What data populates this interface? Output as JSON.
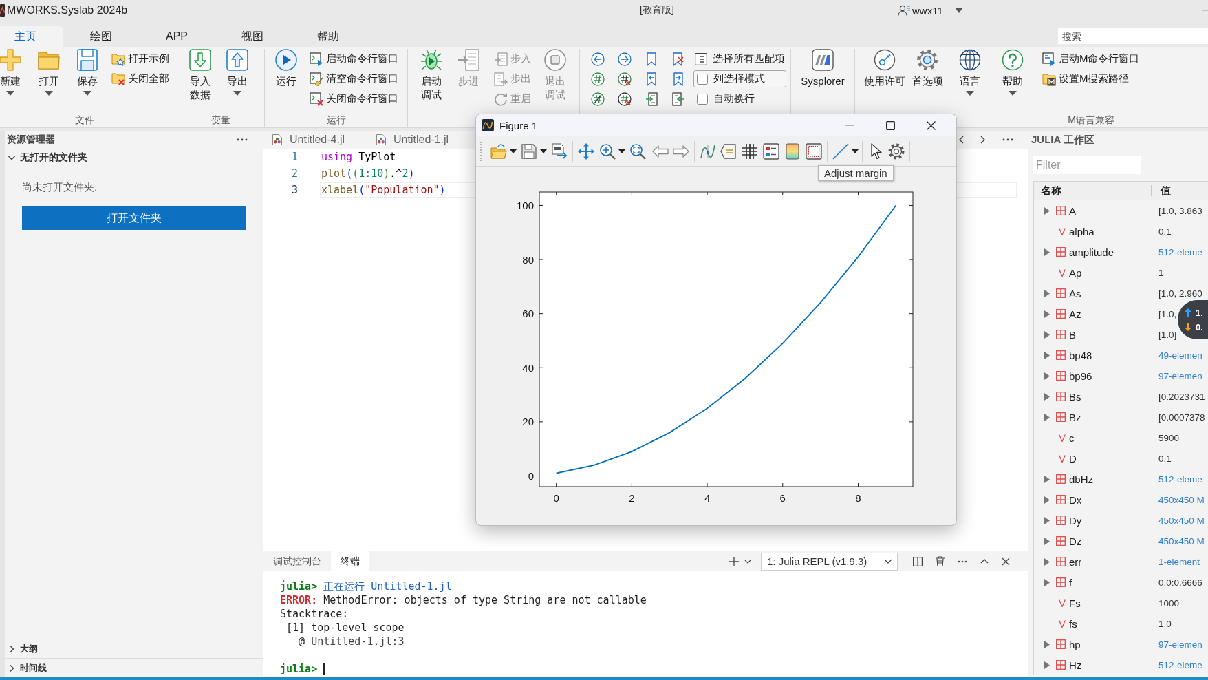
{
  "title_bar": {
    "app_name": "MWORKS.Syslab 2024b",
    "edition": "[教育版]",
    "user": "wwx11"
  },
  "ribbon_tabs": [
    {
      "label": "主页",
      "selected": true
    },
    {
      "label": "绘图",
      "selected": false
    },
    {
      "label": "APP",
      "selected": false
    },
    {
      "label": "视图",
      "selected": false
    },
    {
      "label": "帮助",
      "selected": false
    }
  ],
  "search": {
    "placeholder": "搜索"
  },
  "ribbon": {
    "file_group": {
      "label": "文件",
      "large_buttons": [
        "新建",
        "打开",
        "保存"
      ],
      "small_buttons": [
        "打开示例",
        "关闭全部"
      ]
    },
    "variable_group": {
      "label": "变量",
      "large_buttons": [
        "导入数据",
        "导出"
      ]
    },
    "run_group": {
      "label": "运行",
      "large_buttons": [
        "运行"
      ],
      "small_buttons": [
        "启动命令行窗口",
        "清空命令行窗口",
        "关闭命令行窗口"
      ]
    },
    "debug_group": {
      "large_buttons": [
        {
          "label": "启动调试",
          "disabled": false
        },
        {
          "label": "步进",
          "disabled": true
        },
        {
          "label": "退出调试",
          "disabled": true
        }
      ],
      "small_buttons": [
        {
          "label": "步入",
          "disabled": true
        },
        {
          "label": "步出",
          "disabled": true
        },
        {
          "label": "重启",
          "disabled": true
        }
      ]
    },
    "edit_group": {
      "select_all_button": "选择所有匹配项",
      "checkboxes": [
        {
          "label": "列选择模式",
          "checked": false,
          "focused": true
        },
        {
          "label": "自动换行",
          "checked": false,
          "focused": false
        }
      ]
    },
    "sysplorer_group": {
      "large_buttons": [
        "Sysplorer"
      ]
    },
    "environment_group": {
      "large_buttons": [
        "使用许可",
        "首选项",
        "语言",
        "帮助"
      ]
    },
    "m_language_group": {
      "label": "M语言兼容",
      "small_buttons": [
        "启动M命令行窗口",
        "设置M搜索路径"
      ]
    }
  },
  "explorer": {
    "title": "资源管理器",
    "folder_section": {
      "label": "无打开的文件夹",
      "expanded": true
    },
    "message": "尚未打开文件夹.",
    "open_folder_button": "打开文件夹",
    "bottom_sections": [
      {
        "label": "大纲",
        "expanded": false
      },
      {
        "label": "时间线",
        "expanded": false
      }
    ]
  },
  "editor": {
    "tabs": [
      {
        "label": "Untitled-4.jl"
      },
      {
        "label": "Untitled-1.jl"
      }
    ],
    "lines": [
      {
        "number": "1",
        "current": false,
        "tokens": [
          {
            "text": "using",
            "kind": "keyword"
          },
          {
            "text": " TyPlot",
            "kind": "plain"
          }
        ]
      },
      {
        "number": "2",
        "current": false,
        "tokens": [
          {
            "text": "plot",
            "kind": "function"
          },
          {
            "text": "(",
            "kind": "bracket1"
          },
          {
            "text": "(",
            "kind": "bracket2"
          },
          {
            "text": "1:10",
            "kind": "number"
          },
          {
            "text": ")",
            "kind": "bracket2"
          },
          {
            "text": ".^",
            "kind": "plain"
          },
          {
            "text": "2",
            "kind": "number"
          },
          {
            "text": ")",
            "kind": "bracket1"
          }
        ]
      },
      {
        "number": "3",
        "current": true,
        "tokens": [
          {
            "text": "xlabel",
            "kind": "function"
          },
          {
            "text": "(",
            "kind": "bracket1"
          },
          {
            "text": "\"Population\"",
            "kind": "string"
          },
          {
            "text": ")",
            "kind": "bracket1"
          }
        ]
      }
    ]
  },
  "figure_window": {
    "title": "Figure 1",
    "tooltip": "Adjust margin",
    "chart_data": {
      "type": "line",
      "x": [
        0,
        1,
        2,
        3,
        4,
        5,
        6,
        7,
        8,
        9
      ],
      "series": [
        {
          "color": "#0072bd",
          "values": [
            1,
            4,
            9,
            16,
            25,
            36,
            49,
            64,
            81,
            100
          ]
        }
      ],
      "xlim": [
        -0.45,
        9.45
      ],
      "ylim": [
        -3.95,
        104.95
      ],
      "xticks": [
        0,
        2,
        4,
        6,
        8
      ],
      "yticks": [
        0,
        20,
        40,
        60,
        80,
        100
      ]
    }
  },
  "panel": {
    "tabs": [
      {
        "label": "调试控制台",
        "selected": false
      },
      {
        "label": "终端",
        "selected": true
      }
    ],
    "terminal_selector": "1: Julia REPL (v1.9.3)",
    "terminal_lines": [
      {
        "tokens": [
          {
            "text": "julia>",
            "kind": "prompt"
          },
          {
            "text": " 正在运行 Untitled-1.jl",
            "kind": "info"
          }
        ]
      },
      {
        "tokens": [
          {
            "text": "ERROR:",
            "kind": "error"
          },
          {
            "text": " MethodError: objects of type String are not callable",
            "kind": "plain"
          }
        ]
      },
      {
        "tokens": [
          {
            "text": "Stacktrace:",
            "kind": "plain"
          }
        ]
      },
      {
        "tokens": [
          {
            "text": " [1] top-level scope",
            "kind": "plain"
          }
        ]
      },
      {
        "tokens": [
          {
            "text": "   @ ",
            "kind": "plain"
          },
          {
            "text": "Untitled-1.jl:3",
            "kind": "link"
          }
        ]
      }
    ],
    "input_prompt": "julia>"
  },
  "workspace": {
    "title": "JULIA 工作区",
    "filter": {
      "placeholder": "Filter"
    },
    "columns": [
      "名称",
      "值"
    ],
    "rows": [
      {
        "name": "A",
        "kind": "array",
        "value": "[1.0, 3.863",
        "link": false
      },
      {
        "name": "alpha",
        "kind": "scalar",
        "value": "0.1",
        "link": false
      },
      {
        "name": "amplitude",
        "kind": "array",
        "value": "512-eleme",
        "link": true
      },
      {
        "name": "Ap",
        "kind": "scalar",
        "value": "1",
        "link": false
      },
      {
        "name": "As",
        "kind": "array",
        "value": "[1.0, 2.960",
        "link": false
      },
      {
        "name": "Az",
        "kind": "array",
        "value": "[1.0,",
        "link": false
      },
      {
        "name": "B",
        "kind": "array",
        "value": "[1.0]",
        "link": false
      },
      {
        "name": "bp48",
        "kind": "array",
        "value": "49-elemen",
        "link": true
      },
      {
        "name": "bp96",
        "kind": "array",
        "value": "97-elemen",
        "link": true
      },
      {
        "name": "Bs",
        "kind": "array",
        "value": "[0.2023731",
        "link": false
      },
      {
        "name": "Bz",
        "kind": "array",
        "value": "[0.0007378",
        "link": false
      },
      {
        "name": "c",
        "kind": "scalar",
        "value": "5900",
        "link": false
      },
      {
        "name": "D",
        "kind": "scalar",
        "value": "0.1",
        "link": false
      },
      {
        "name": "dbHz",
        "kind": "array",
        "value": "512-eleme",
        "link": true
      },
      {
        "name": "Dx",
        "kind": "array",
        "value": "450x450 M",
        "link": true
      },
      {
        "name": "Dy",
        "kind": "array",
        "value": "450x450 M",
        "link": true
      },
      {
        "name": "Dz",
        "kind": "array",
        "value": "450x450 M",
        "link": true
      },
      {
        "name": "err",
        "kind": "array",
        "value": "1-element",
        "link": true
      },
      {
        "name": "f",
        "kind": "array",
        "value": "0.0:0.6666",
        "link": false
      },
      {
        "name": "Fs",
        "kind": "scalar",
        "value": "1000",
        "link": false
      },
      {
        "name": "fs",
        "kind": "scalar",
        "value": "1.0",
        "link": false
      },
      {
        "name": "hp",
        "kind": "array",
        "value": "97-elemen",
        "link": true
      },
      {
        "name": "Hz",
        "kind": "array",
        "value": "512-eleme",
        "link": true
      }
    ]
  },
  "speed_overlay": {
    "readings": [
      "1.",
      "0."
    ]
  }
}
